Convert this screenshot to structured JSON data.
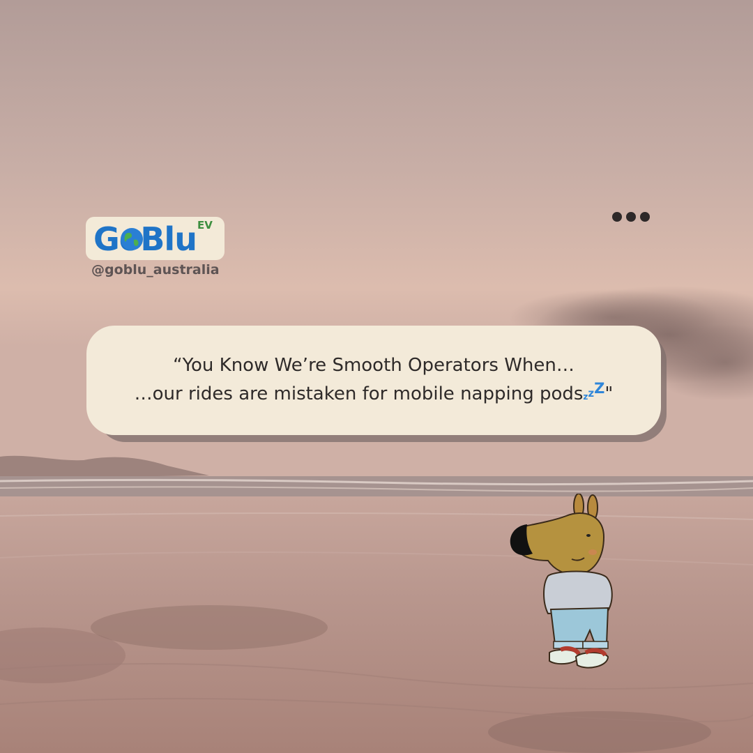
{
  "brand": {
    "logo_text": "GoBlu",
    "logo_superscript": "EV",
    "handle": "@goblu_australia"
  },
  "menu": {
    "icon": "more-dots-icon"
  },
  "quote": {
    "line1": "“You Know We’re Smooth Operators When…",
    "line2": "…our rides are mistaken for mobile napping pods",
    "sleep_symbol": "zzZ",
    "closing_mark": "\""
  },
  "colors": {
    "sky_top": "#b79e98",
    "sky_horizon": "#dcbfb0",
    "sand": "#b89088",
    "bubble": "#f3ead9",
    "brand_blue": "#1f74c7",
    "brand_green": "#3d8f3f"
  }
}
